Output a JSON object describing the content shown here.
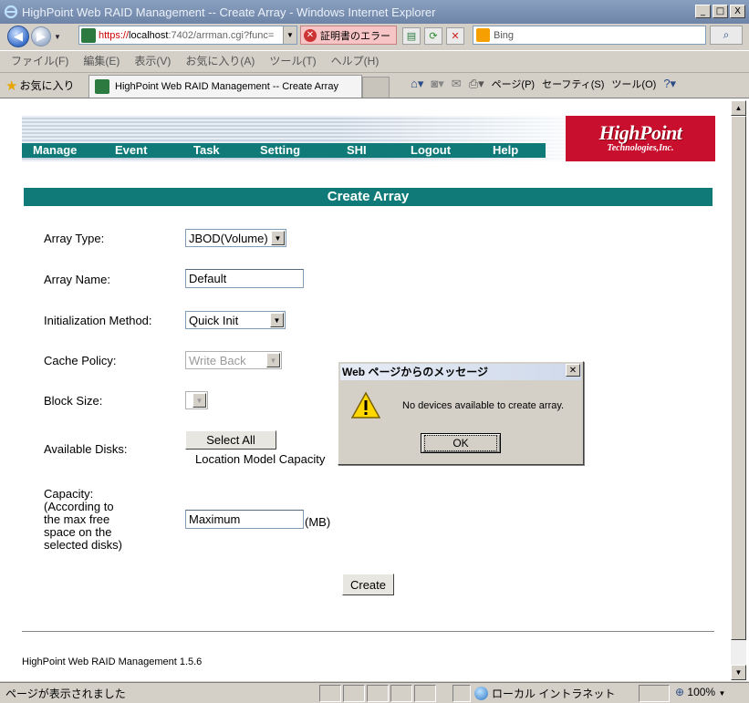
{
  "window": {
    "title": "HighPoint Web RAID Management -- Create Array - Windows Internet Explorer",
    "controls": {
      "minimize": "_",
      "maximize": "□",
      "close": "X"
    }
  },
  "address_bar": {
    "url_scheme": "https://",
    "url_host": "localhost",
    "url_rest": ":7402/arrman.cgi?func=",
    "cert_error": "証明書のエラー",
    "search_placeholder": "Bing"
  },
  "menu": [
    "ファイル(F)",
    "編集(E)",
    "表示(V)",
    "お気に入り(A)",
    "ツール(T)",
    "ヘルプ(H)"
  ],
  "favorites": {
    "label": "お気に入り",
    "tab_title": "HighPoint Web RAID Management -- Create Array"
  },
  "command_bar": {
    "page": "ページ(P)",
    "safety": "セーフティ(S)",
    "tools": "ツール(O)"
  },
  "site": {
    "nav": [
      "Manage",
      "Event",
      "Task",
      "Setting",
      "SHI",
      "Logout",
      "Help"
    ],
    "logo_main": "HighPoint",
    "logo_sub": "Technologies,Inc.",
    "section_title": "Create Array"
  },
  "form": {
    "array_type": {
      "label": "Array Type:",
      "value": "JBOD(Volume)"
    },
    "array_name": {
      "label": "Array Name:",
      "value": "Default"
    },
    "init_method": {
      "label": "Initialization Method:",
      "value": "Quick Init"
    },
    "cache_policy": {
      "label": "Cache Policy:",
      "value": "Write Back"
    },
    "block_size": {
      "label": "Block Size:",
      "value": ""
    },
    "available_disks": {
      "label": "Available Disks:",
      "select_all": "Select All",
      "columns": "Location Model Capacity"
    },
    "capacity": {
      "label_lines": [
        "Capacity:",
        "(According to",
        "the max free",
        "space on the",
        "selected disks)"
      ],
      "value": "Maximum",
      "unit": "(MB)"
    },
    "create_button": "Create"
  },
  "footer": "HighPoint Web RAID Management 1.5.6",
  "dialog": {
    "title": "Web ページからのメッセージ",
    "message": "No devices available to create array.",
    "ok": "OK"
  },
  "status": {
    "text": "ページが表示されました",
    "zone": "ローカル イントラネット",
    "zoom": "100%"
  }
}
